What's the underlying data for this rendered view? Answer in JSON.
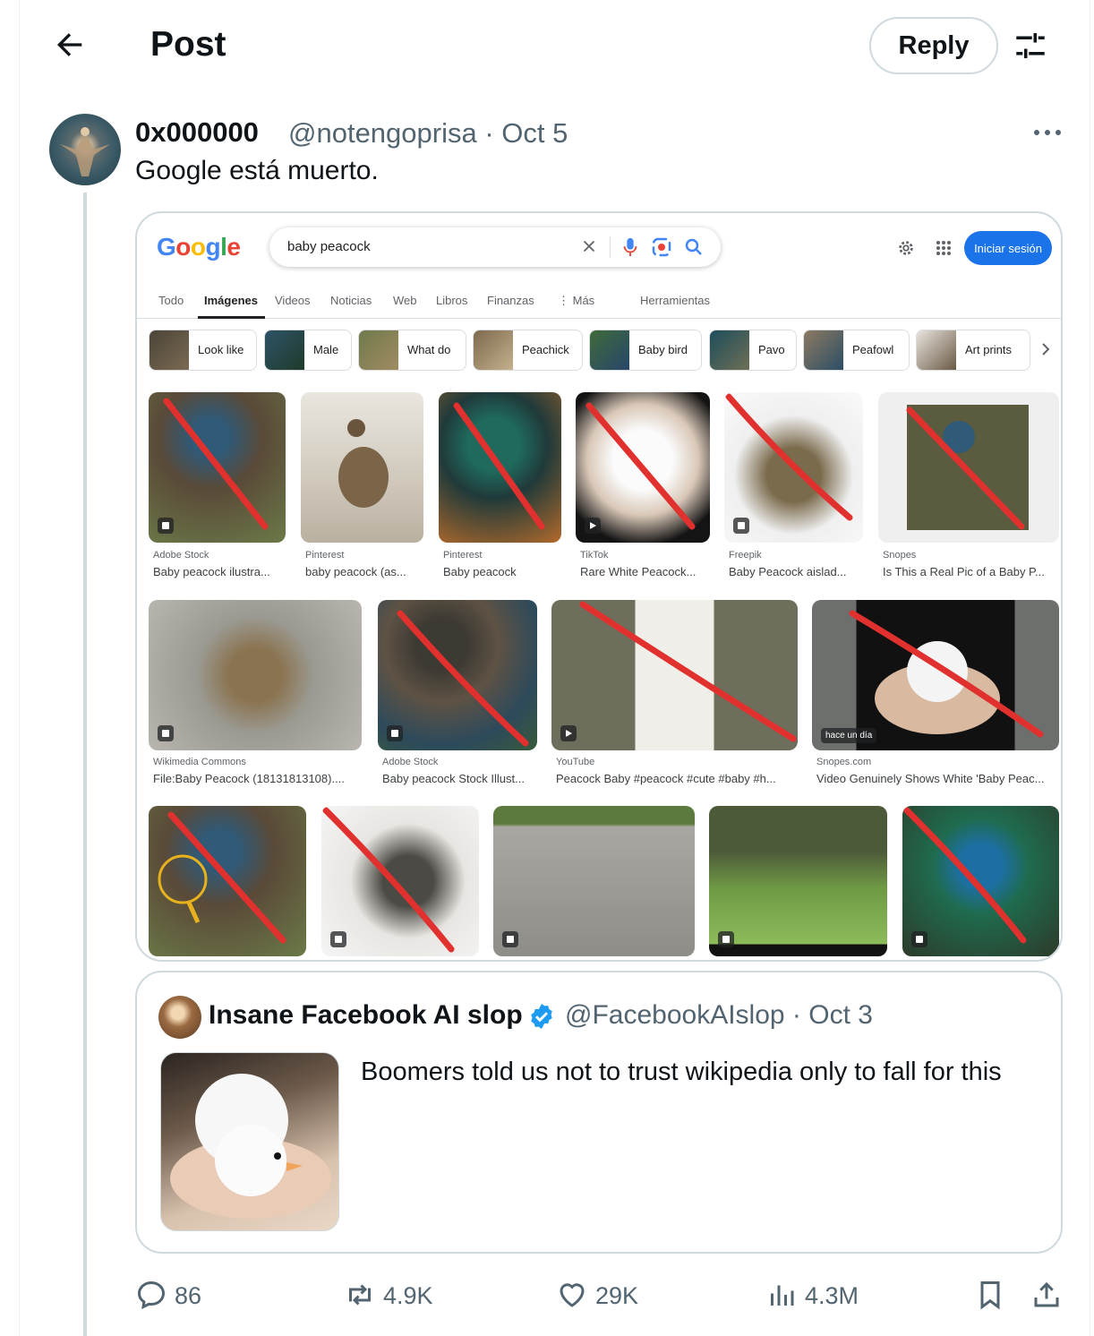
{
  "header": {
    "title": "Post",
    "reply_label": "Reply"
  },
  "tweet": {
    "author_name": "0x000000",
    "handle_date": "@notengoprisa · Oct 5",
    "text": "Google está muerto."
  },
  "google": {
    "logo": [
      "G",
      "o",
      "o",
      "g",
      "l",
      "e"
    ],
    "query": "baby peacock",
    "signin": "Iniciar sesión",
    "tabs": [
      "Todo",
      "Imágenes",
      "Videos",
      "Noticias",
      "Web",
      "Libros",
      "Finanzas",
      "⋮ Más",
      "Herramientas"
    ],
    "chips": [
      "Look like",
      "Male",
      "What do",
      "Peachick",
      "Baby bird",
      "Pavo",
      "Peafowl",
      "Art prints"
    ],
    "results": [
      {
        "source": "Adobe Stock",
        "title": "Baby peacock ilustra..."
      },
      {
        "source": "Pinterest",
        "title": "baby peacock (as..."
      },
      {
        "source": "Pinterest",
        "title": "Baby peacock"
      },
      {
        "source": "TikTok",
        "title": "Rare White Peacock..."
      },
      {
        "source": "Freepik",
        "title": "Baby Peacock aislad..."
      },
      {
        "source": "Snopes",
        "title": "Is This a Real Pic of a Baby P..."
      },
      {
        "source": "Wikimedia Commons",
        "title": "File:Baby Peacock (18131813108)...."
      },
      {
        "source": "Adobe Stock",
        "title": "Baby peacock Stock Illust..."
      },
      {
        "source": "YouTube",
        "title": "Peacock Baby #peacock #cute #baby #h..."
      },
      {
        "source": "Snopes.com",
        "title": "Video Genuinely Shows White 'Baby Peac..."
      }
    ],
    "time_tag": "hace un día"
  },
  "quote": {
    "name": "Insane Facebook AI slop",
    "handle_date": "@FacebookAIslop · Oct 3",
    "text": "Boomers told us not to trust wikipedia only to fall for this"
  },
  "actions": {
    "replies": "86",
    "reposts": "4.9K",
    "likes": "29K",
    "views": "4.3M"
  },
  "icons": [
    "back-arrow-icon",
    "settings-sliders-icon",
    "more-icon",
    "verified-icon",
    "reply-icon",
    "repost-icon",
    "like-icon",
    "views-icon",
    "bookmark-icon",
    "share-icon"
  ],
  "colors": {
    "accent": "#1d9bf0",
    "text": "#0f1419",
    "muted": "#536471",
    "slash": "#e0312f",
    "google_blue": "#1a73e8"
  }
}
